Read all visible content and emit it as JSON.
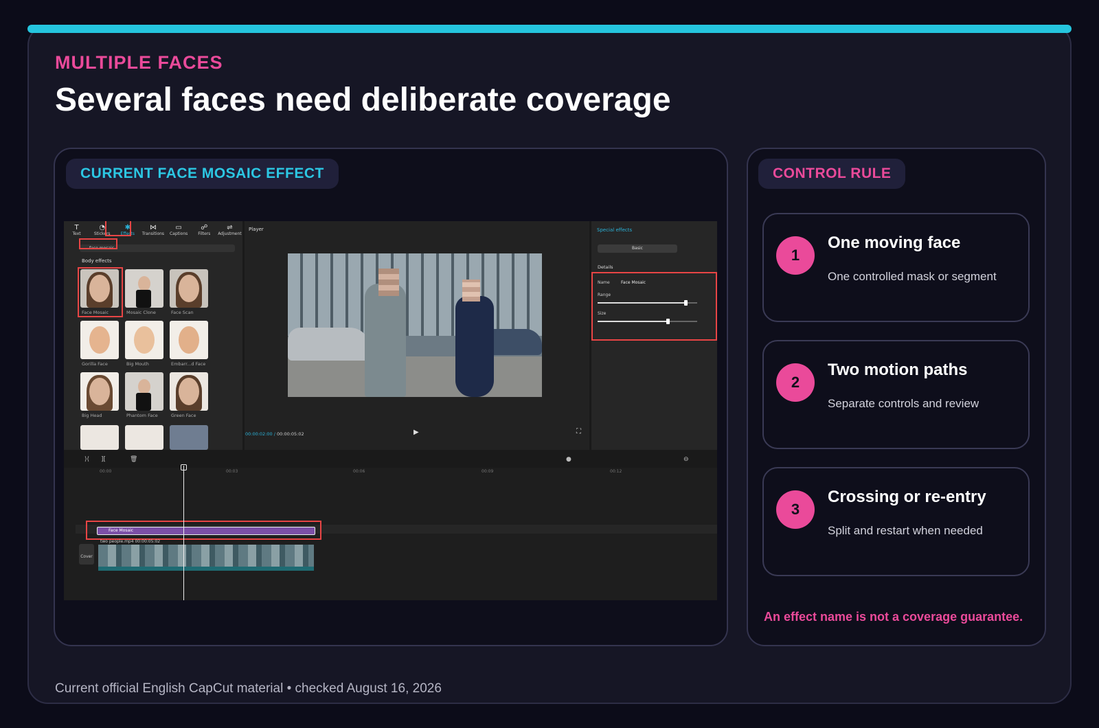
{
  "header": {
    "eyebrow": "MULTIPLE FACES",
    "title": "Several faces need deliberate coverage"
  },
  "left_panel": {
    "label": "CURRENT FACE MOSAIC EFFECT",
    "app": {
      "toolbar": [
        {
          "label": "Text",
          "icon": "text-icon"
        },
        {
          "label": "Stickers",
          "icon": "sticker-icon"
        },
        {
          "label": "Effects",
          "icon": "effects-icon"
        },
        {
          "label": "Transitions",
          "icon": "transitions-icon"
        },
        {
          "label": "Captions",
          "icon": "captions-icon"
        },
        {
          "label": "Filters",
          "icon": "filters-icon"
        },
        {
          "label": "Adjustment",
          "icon": "adjustment-icon"
        }
      ],
      "search_value": "face mosaic",
      "section": "Body effects",
      "effects": [
        "Face Mosaic",
        "Mosaic Clone",
        "Face Scan",
        "Gorilla Face",
        "Big Mouth",
        "Embarr...d Face",
        "Big Head",
        "Phantom Face",
        "Green Face"
      ],
      "player_title": "Player",
      "timecode_current": "00:00:02:00",
      "timecode_total": "00:00:05:02",
      "props_title": "Special effects",
      "props_tab": "Basic",
      "details_label": "Details",
      "name_label": "Name",
      "name_value": "Face Mosaic",
      "range_label": "Range",
      "range_level": 0.88,
      "size_label": "Size",
      "size_level": 0.7,
      "ruler": [
        "00:00",
        "00:03",
        "00:06",
        "00:09",
        "00:12"
      ],
      "fx_clip": "Face Mosaic",
      "video_clip": "two people.mp4",
      "video_clip_duration": "00:00:05:02",
      "cover_label": "Cover"
    }
  },
  "right_panel": {
    "label": "CONTROL RULE",
    "rules": [
      {
        "num": "1",
        "title": "One moving face",
        "sub": "One controlled mask or segment"
      },
      {
        "num": "2",
        "title": "Two motion paths",
        "sub": "Separate controls and review"
      },
      {
        "num": "3",
        "title": "Crossing or re-entry",
        "sub": "Split and restart when needed"
      }
    ],
    "warning": "An effect name is not a coverage guarantee."
  },
  "footer": "Current official English CapCut material • checked August 16, 2026",
  "colors": {
    "accent": "#25c5de",
    "pink": "#ea4a9a",
    "background": "#0c0c19"
  }
}
